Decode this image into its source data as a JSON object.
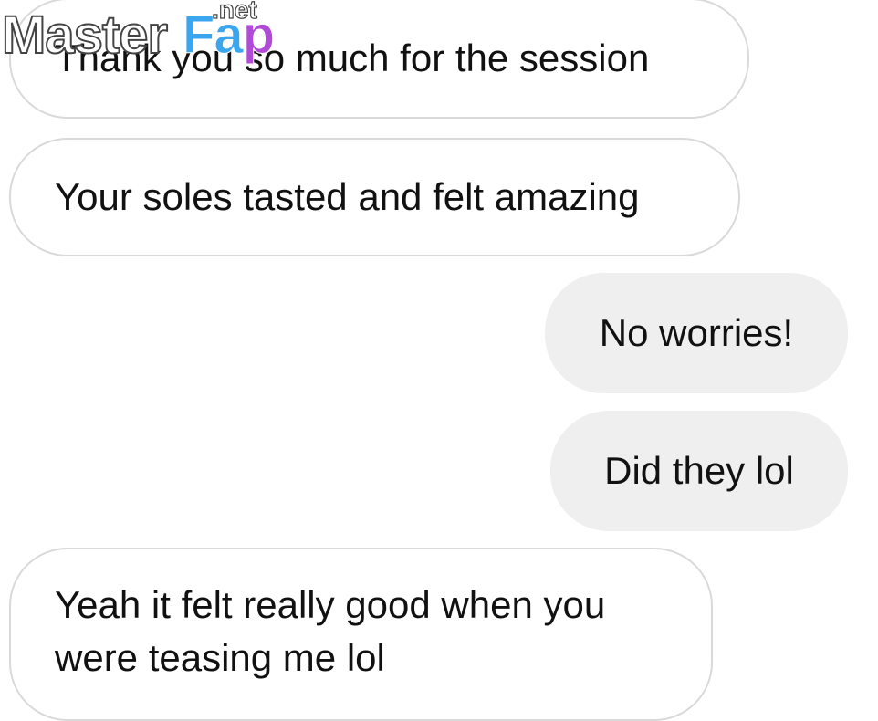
{
  "messages": [
    {
      "direction": "incoming",
      "text": "Thank you so much for the session"
    },
    {
      "direction": "incoming",
      "text": "Your soles tasted and felt amazing"
    },
    {
      "direction": "outgoing",
      "text": "No worries!"
    },
    {
      "direction": "outgoing",
      "text": "Did they lol"
    },
    {
      "direction": "incoming",
      "text": "Yeah it felt really good when you were teasing me lol"
    }
  ],
  "watermark": {
    "brand": "Master",
    "brand_accent": "Fa",
    "brand_accent_end": "p",
    "suffix": ".net"
  },
  "colors": {
    "incoming_bubble": "#ffffff",
    "incoming_border": "#d9d9d9",
    "outgoing_bubble": "#efefef",
    "text": "#111111"
  }
}
